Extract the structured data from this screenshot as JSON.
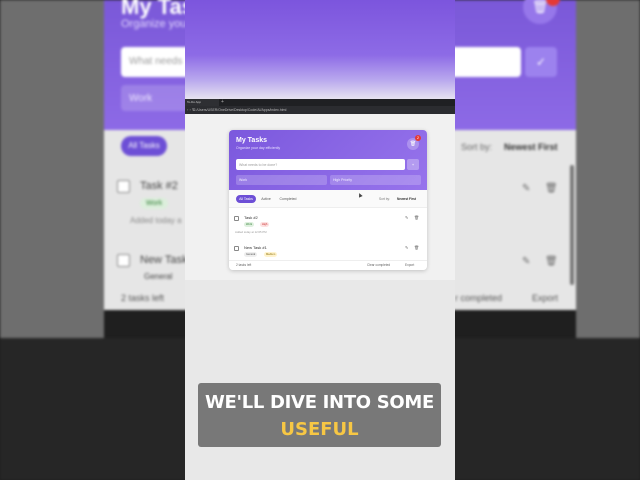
{
  "app": {
    "title": "My Tasks",
    "subtitle": "Organize your day efficiently",
    "clear_badge": "2",
    "input_placeholder": "What needs to be done?",
    "add_label": "+",
    "category_value": "Work",
    "priority_value": "High Priority"
  },
  "browser": {
    "tab_title": "To-Do App",
    "new_tab": "+",
    "url": "C:/Users/USER/OneDrive/Desktop/Code/AI/Apps/index.html",
    "nav": "‹ › ↻"
  },
  "filters": {
    "tabs": [
      "All Tasks",
      "Active",
      "Completed"
    ],
    "sort_label": "Sort by:",
    "sort_value": "Newest First"
  },
  "tasks": [
    {
      "name": "Task #2",
      "tags": [
        "Work",
        "High"
      ],
      "meta": "Added today at 12:05 PM"
    },
    {
      "name": "New Task #1",
      "tags": [
        "General",
        "Medium"
      ],
      "meta": ""
    }
  ],
  "footer": {
    "tasks_left": "2 tasks left",
    "clear_completed": "Clear completed",
    "export": "Export"
  },
  "background": {
    "title": "My Task",
    "subtitle": "Organize your d",
    "input_placeholder": "What needs",
    "category": "Work",
    "tab_all": "All Tasks",
    "sort_by": "Sort by:",
    "sort_value": "Newest First",
    "task1": "Task #2",
    "task1_tag": "Work",
    "task1_note": "Added today a",
    "task2": "New Task",
    "task2_tag": "General",
    "tasks_left": "2 tasks left",
    "clear_completed": "r completed",
    "export": "Export"
  },
  "caption": {
    "line1": "WE'LL DIVE INTO SOME",
    "line2": "USEFUL"
  },
  "colors": {
    "accent": "#6d4fd6",
    "header_start": "#7b58dd",
    "header_end": "#9774ec",
    "caption_highlight": "#f7c744"
  }
}
